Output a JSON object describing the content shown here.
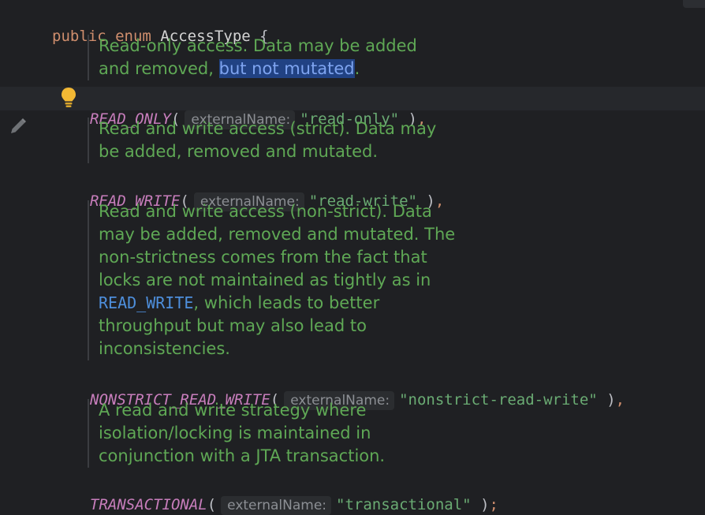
{
  "header": {
    "kw_public": "public",
    "kw_enum": "enum",
    "enum_name": "AccessType",
    "open_brace": "{"
  },
  "hint_label": "externalName:",
  "docs": {
    "read_only": {
      "line1": "Read-only access. Data may be added",
      "line2_pre": "and removed, ",
      "line2_sel": "but not mutated",
      "line2_post": "."
    },
    "read_write": [
      "Read and write access (strict). Data may",
      "be added, removed and mutated."
    ],
    "nonstrict": {
      "lines": [
        "Read and write access (non-strict). Data",
        "may be added, removed and mutated. The",
        "non-strictness comes from the fact that",
        "locks are not maintained as tightly as in"
      ],
      "link": "READ_WRITE",
      "link_rest": ", which leads to better",
      "tail": [
        "throughput but may also lead to",
        "inconsistencies."
      ]
    },
    "transactional": [
      "A read and write strategy where",
      "isolation/locking is maintained in",
      "conjunction with a JTA transaction."
    ]
  },
  "constants": [
    {
      "name": "READ_ONLY",
      "value": "\"read-only\"",
      "end": "),"
    },
    {
      "name": "READ_WRITE",
      "value": "\"read-write\"",
      "end": "),"
    },
    {
      "name": "NONSTRICT_READ_WRITE",
      "value": "\"nonstrict-read-write\"",
      "end": "),"
    },
    {
      "name": "TRANSACTIONAL",
      "value": "\"transactional\"",
      "end": ");"
    }
  ],
  "paren_open": "(",
  "icons": {
    "bulb": "lightbulb-icon",
    "pencil": "pencil-icon"
  },
  "colors": {
    "background": "#1f2023",
    "keyword": "#cf8e6d",
    "enum_constant": "#c77dbb",
    "string": "#6aab73",
    "doc_comment": "#5fa855",
    "selection": "#214283"
  }
}
